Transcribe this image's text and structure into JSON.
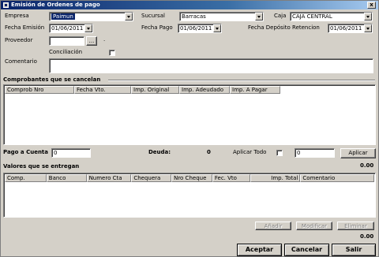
{
  "window": {
    "title": "Emisión de Ordenes de pago",
    "close_glyph": "x"
  },
  "header": {
    "empresa_label": "Empresa",
    "empresa_value": "Paimun",
    "sucursal_label": "Sucursal",
    "sucursal_value": "Barracas",
    "caja_label": "Caja",
    "caja_value": "CAJA CENTRAL",
    "fecha_emision_label": "Fecha Emisión",
    "fecha_emision_value": "01/06/2011",
    "fecha_pago_label": "Fecha Pago",
    "fecha_pago_value": "01/06/2011",
    "fecha_deposito_label": "Fecha Depósito Retencion",
    "fecha_deposito_value": "01/06/2011",
    "proveedor_label": "Proveedor",
    "proveedor_value": "",
    "proveedor_browse_label": "...",
    "proveedor_name": ".",
    "conciliacion_label": "Conciliación",
    "conciliacion_checked": false,
    "comentario_label": "Comentario",
    "comentario_value": ""
  },
  "comprobantes": {
    "section_label": "Comprobantes que se cancelan",
    "columns": [
      "Comprob Nro",
      "Fecha Vto.",
      "Imp. Original",
      "Imp. Adeudado",
      "Imp. A Pagar"
    ],
    "rows": []
  },
  "pago": {
    "pago_a_cuenta_label": "Pago a Cuenta",
    "pago_a_cuenta_value": "0",
    "deuda_label": "Deuda:",
    "deuda_value": "0",
    "aplicar_todo_label": "Aplicar Todo",
    "aplicar_todo_checked": false,
    "aplicar_value": "0",
    "aplicar_button": "Aplicar",
    "total_comprobantes": "0.00"
  },
  "valores": {
    "section_label": "Valores que se entregan",
    "columns": [
      "Comp.",
      "Banco",
      "Numero Cta",
      "Chequera",
      "Nro Cheque",
      "Fec. Vto",
      "Imp. Total",
      "Comentario"
    ],
    "rows": [],
    "add_button": "Añadir",
    "modify_button": "Modificar",
    "delete_button": "Eliminar",
    "total": "0.00"
  },
  "footer": {
    "accept_button": "Aceptar",
    "cancel_button": "Cancelar",
    "exit_button": "Salir"
  }
}
